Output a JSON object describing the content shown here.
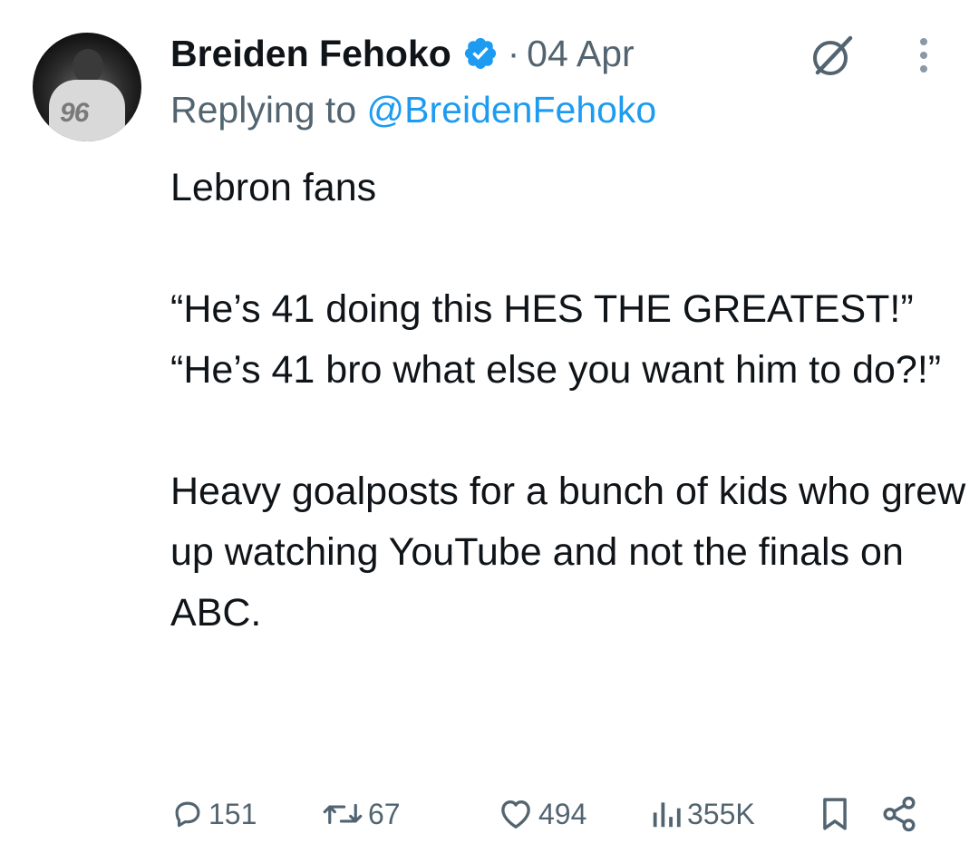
{
  "tweet": {
    "author_name": "Breiden Fehoko",
    "verified": true,
    "separator": "·",
    "date": "04 Apr",
    "reply_prefix": "Replying to",
    "reply_handle": "@BreidenFehoko",
    "body": "Lebron fans\n\n“He’s 41 doing this HES THE GREATEST!”\n“He’s 41 bro what else you want him to do?!”\n\nHeavy goalposts for a bunch of kids who grew up watching YouTube and not the finals on ABC.",
    "avatar_number": "96"
  },
  "actions": {
    "replies": "151",
    "reposts": "67",
    "likes": "494",
    "views": "355K"
  },
  "icons": [
    "verified-badge-icon",
    "grok-icon",
    "more-icon",
    "reply-icon",
    "repost-icon",
    "like-icon",
    "views-icon",
    "bookmark-icon",
    "share-icon"
  ],
  "colors": {
    "text": "#0f1419",
    "secondary": "#536471",
    "accent": "#1d9bf0"
  }
}
